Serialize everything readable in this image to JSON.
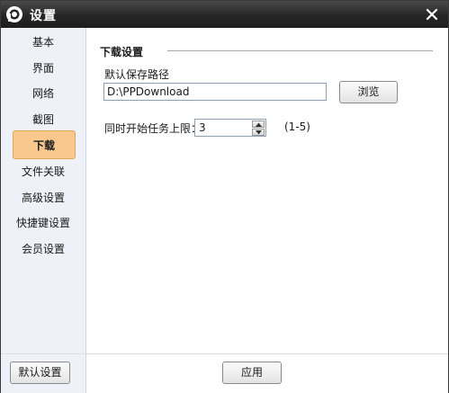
{
  "window": {
    "title": "设置"
  },
  "sidebar": {
    "items": [
      {
        "label": "基本"
      },
      {
        "label": "界面"
      },
      {
        "label": "网络"
      },
      {
        "label": "截图"
      },
      {
        "label": "下载",
        "active": true
      },
      {
        "label": "文件关联"
      },
      {
        "label": "高级设置"
      },
      {
        "label": "快捷键设置"
      },
      {
        "label": "会员设置"
      }
    ]
  },
  "content": {
    "section_title": "下载设置",
    "path_label": "默认保存路径",
    "path_value": "D:\\PPDownload",
    "browse_label": "浏览",
    "task_label": "同时开始任务上限：",
    "task_value": "3",
    "task_range": "(1-5)"
  },
  "footer": {
    "default_label": "默认设置",
    "apply_label": "应用"
  },
  "colors": {
    "titlebar": "#262626",
    "sidebar_bg": "#eef1f7",
    "active_item": "#f8c88e"
  },
  "icons": {
    "app": "pptv-logo-icon",
    "close": "close-icon"
  }
}
